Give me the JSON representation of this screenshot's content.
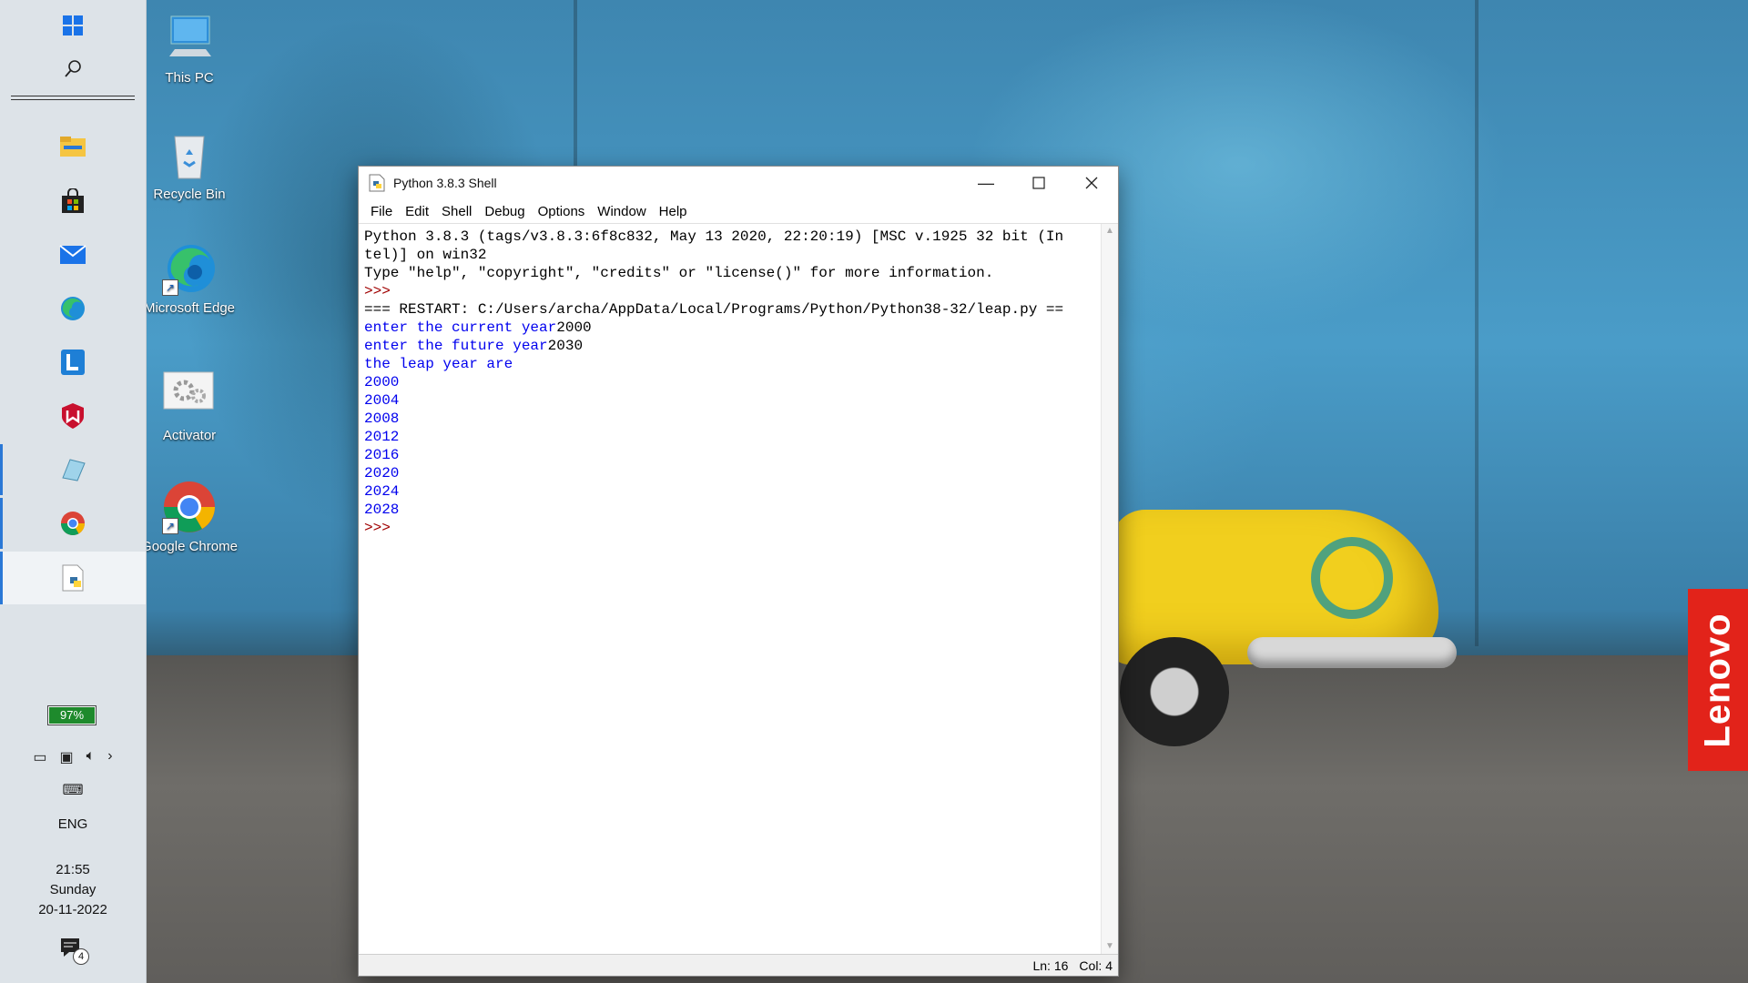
{
  "desktop": {
    "icons": [
      {
        "label": "This PC"
      },
      {
        "label": "Recycle Bin"
      },
      {
        "label": "Microsoft Edge"
      },
      {
        "label": "Activator"
      },
      {
        "label": "Google Chrome"
      }
    ],
    "brand": "Lenovo"
  },
  "taskbar": {
    "battery": "97%",
    "language": "ENG",
    "time": "21:55",
    "day": "Sunday",
    "date": "20-11-2022",
    "notification_count": "4"
  },
  "window": {
    "title": "Python 3.8.3 Shell",
    "menu": [
      "File",
      "Edit",
      "Shell",
      "Debug",
      "Options",
      "Window",
      "Help"
    ],
    "shell_lines": [
      {
        "text": "Python 3.8.3 (tags/v3.8.3:6f8c832, May 13 2020, 22:20:19) [MSC v.1925 32 bit (In",
        "kind": "info"
      },
      {
        "text": "tel)] on win32",
        "kind": "info"
      },
      {
        "text": "Type \"help\", \"copyright\", \"credits\" or \"license()\" for more information.",
        "kind": "info"
      },
      {
        "text": ">>> ",
        "kind": "prompt"
      },
      {
        "text": "=== RESTART: C:/Users/archa/AppData/Local/Programs/Python/Python38-32/leap.py ==",
        "kind": "info"
      },
      {
        "prompt": "enter the current year",
        "input": "2000",
        "kind": "input"
      },
      {
        "prompt": "enter the future year",
        "input": "2030",
        "kind": "input"
      },
      {
        "text": "the leap year are",
        "kind": "out"
      },
      {
        "text": "2000",
        "kind": "out"
      },
      {
        "text": "2004",
        "kind": "out"
      },
      {
        "text": "2008",
        "kind": "out"
      },
      {
        "text": "2012",
        "kind": "out"
      },
      {
        "text": "2016",
        "kind": "out"
      },
      {
        "text": "2020",
        "kind": "out"
      },
      {
        "text": "2024",
        "kind": "out"
      },
      {
        "text": "2028",
        "kind": "out"
      },
      {
        "text": ">>> ",
        "kind": "prompt"
      }
    ],
    "status": {
      "line": "Ln: 16",
      "col": "Col: 4"
    }
  }
}
